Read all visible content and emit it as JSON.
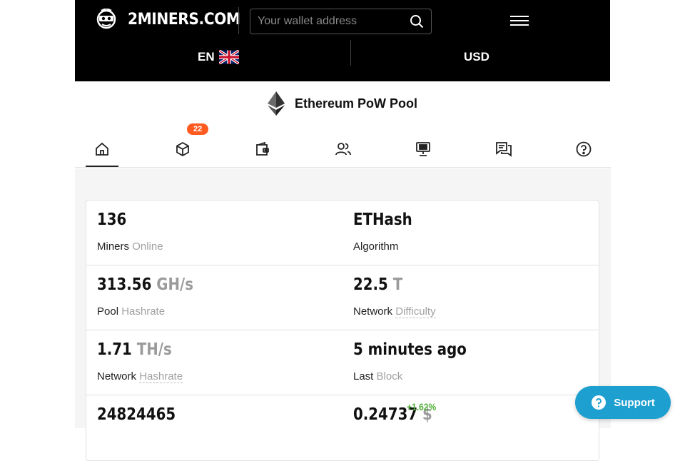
{
  "header": {
    "logo_text": "2MINERS.COM",
    "search_placeholder": "Your wallet address",
    "language": "EN",
    "currency": "USD"
  },
  "pool": {
    "title": "Ethereum PoW Pool"
  },
  "tabs": [
    {
      "name": "home",
      "icon": "home-icon",
      "active": true
    },
    {
      "name": "blocks",
      "icon": "cube-icon",
      "badge": "22"
    },
    {
      "name": "payments",
      "icon": "wallet-icon"
    },
    {
      "name": "miners",
      "icon": "users-icon"
    },
    {
      "name": "connect",
      "icon": "computer-icon"
    },
    {
      "name": "chat",
      "icon": "chat-icon"
    },
    {
      "name": "help",
      "icon": "question-icon"
    }
  ],
  "stats": {
    "miners_online": {
      "value": "136",
      "label": "Miners",
      "sub": "Online"
    },
    "algorithm": {
      "value": "ETHash",
      "label": "Algorithm"
    },
    "pool_hashrate": {
      "value": "313.56",
      "unit": "GH/s",
      "label": "Pool",
      "sub": "Hashrate"
    },
    "network_difficulty": {
      "value": "22.5",
      "unit": "T",
      "label": "Network",
      "sub": "Difficulty"
    },
    "network_hashrate": {
      "value": "1.71",
      "unit": "TH/s",
      "label": "Network",
      "sub": "Hashrate"
    },
    "last_block": {
      "value": "5 minutes ago",
      "label": "Last",
      "sub": "Block"
    },
    "block_height": {
      "value": "24824465"
    },
    "price": {
      "value": "0.24737",
      "unit": "$",
      "change": "+1.62%"
    }
  },
  "support": {
    "label": "Support"
  },
  "colors": {
    "header_bg": "#000000",
    "badge": "#ff5a1f",
    "support_bg": "#1d9fd0",
    "positive": "#56b03c"
  }
}
